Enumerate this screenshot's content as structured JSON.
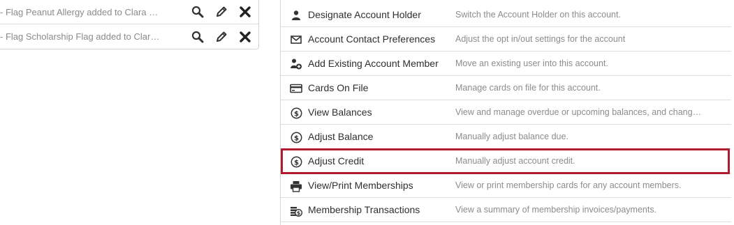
{
  "flags": {
    "items": [
      {
        "text": "- Flag Peanut Allergy added to Clara Sie..."
      },
      {
        "text": "- Flag Scholarship Flag added to Clara Si..."
      }
    ],
    "actions": [
      "search-icon",
      "pencil-icon",
      "close-icon"
    ]
  },
  "account_actions": {
    "items": [
      {
        "title": "Designate Account Holder",
        "description": "Switch the Account Holder on this account.",
        "icon": "person-icon"
      },
      {
        "title": "Account Contact Preferences",
        "description": "Adjust the opt in/out settings for the account",
        "icon": "envelope-icon"
      },
      {
        "title": "Add Existing Account Member",
        "description": "Move an existing user into this account.",
        "icon": "person-add-icon"
      },
      {
        "title": "Cards On File",
        "description": "Manage cards on file for this account.",
        "icon": "credit-card-icon"
      },
      {
        "title": "View Balances",
        "description": "View and manage overdue or upcoming balances, and change t...",
        "icon": "dollar-circle-icon"
      },
      {
        "title": "Adjust Balance",
        "description": "Manually adjust balance due.",
        "icon": "dollar-circle-icon"
      },
      {
        "title": "Adjust Credit",
        "description": "Manually adjust account credit.",
        "icon": "dollar-circle-icon"
      },
      {
        "title": "View/Print Memberships",
        "description": "View or print membership cards for any account members.",
        "icon": "printer-icon"
      },
      {
        "title": "Membership Transactions",
        "description": "View a summary of membership invoices/payments.",
        "icon": "coins-icon"
      }
    ],
    "highlighted": "Adjust Credit"
  },
  "colors": {
    "highlight": "#b01c2e",
    "icon": "#333333",
    "muted_text": "#8c8c8c"
  }
}
